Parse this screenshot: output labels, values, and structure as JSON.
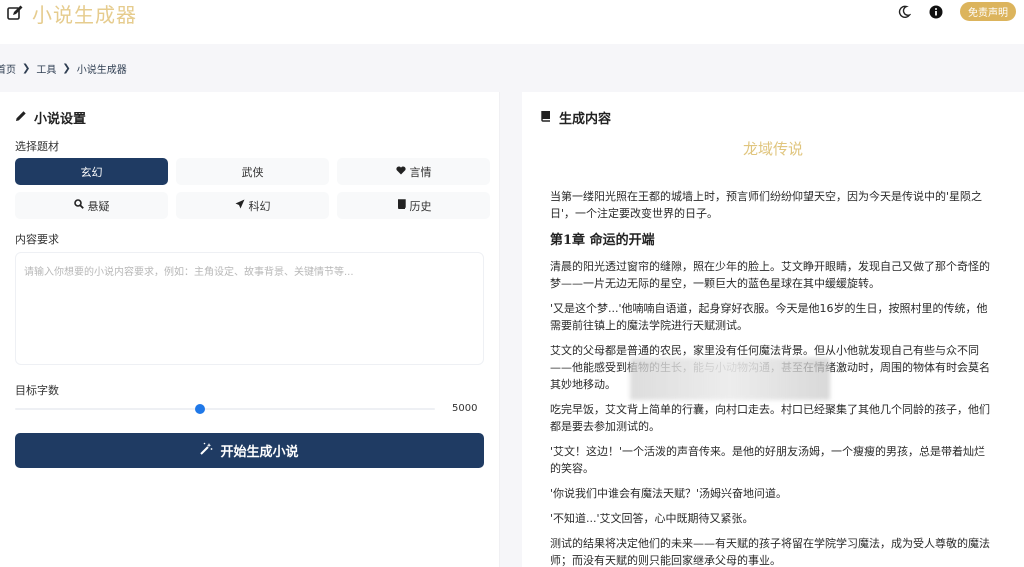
{
  "header": {
    "app_title": "小说生成器",
    "theme_icon": "moon-icon",
    "info_icon": "info-circle-icon",
    "disclaimer_label": "免责声明",
    "brand_icon": "edit-square-icon"
  },
  "breadcrumb": {
    "items": [
      "首页",
      "工具",
      "小说生成器"
    ],
    "separator_icon": "chevron-right-icon"
  },
  "settings": {
    "title": "小说设置",
    "title_icon": "pencil-icon",
    "genre_label": "选择题材",
    "genres": [
      {
        "label": "玄幻",
        "icon": "",
        "active": true
      },
      {
        "label": "武侠",
        "icon": "",
        "active": false
      },
      {
        "label": "言情",
        "icon": "heart-icon",
        "active": false
      },
      {
        "label": "悬疑",
        "icon": "search-icon",
        "active": false
      },
      {
        "label": "科幻",
        "icon": "rocket-icon",
        "active": false
      },
      {
        "label": "历史",
        "icon": "book-icon",
        "active": false
      }
    ],
    "content_label": "内容要求",
    "content_placeholder": "请输入你想要的小说内容要求，例如：主角设定、故事背景、关键情节等...",
    "word_count_label": "目标字数",
    "word_count_value": "5000",
    "slider_fraction": 0.44,
    "generate_label": "开始生成小说",
    "generate_icon": "magic-wand-icon"
  },
  "output": {
    "title": "生成内容",
    "title_icon": "book-icon",
    "story_title": "龙域传说",
    "intro": "当第一缕阳光照在王都的城墙上时，预言师们纷纷仰望天空，因为今天是传说中的'星陨之日'，一个注定要改变世界的日子。",
    "chapter_heading": "第1章 命运的开端",
    "paragraphs": [
      "清晨的阳光透过窗帘的缝隙，照在少年的脸上。艾文睁开眼睛，发现自己又做了那个奇怪的梦——一片无边无际的星空，一颗巨大的蓝色星球在其中缓缓旋转。",
      "'又是这个梦...'他喃喃自语道，起身穿好衣服。今天是他16岁的生日，按照村里的传统，他需要前往镇上的魔法学院进行天赋测试。",
      "艾文的父母都是普通的农民，家里没有任何魔法背景。但从小他就发现自己有些与众不同——他能感受到植物的生长，能与小动物沟通，甚至在情绪激动时，周围的物体有时会莫名其妙地移动。",
      "吃完早饭，艾文背上简单的行囊，向村口走去。村口已经聚集了其他几个同龄的孩子，他们都是要去参加测试的。",
      "'艾文！这边！'一个活泼的声音传来。是他的好朋友汤姆，一个瘦瘦的男孩，总是带着灿烂的笑容。",
      "'你说我们中谁会有魔法天赋？'汤姆兴奋地问道。",
      "'不知道...'艾文回答，心中既期待又紧张。",
      "测试的结果将决定他们的未来——有天赋的孩子将留在学院学习魔法，成为受人尊敬的魔法师；而没有天赋的则只能回家继承父母的事业。"
    ]
  },
  "colors": {
    "primary": "#1f3b63",
    "accent_gold": "#dcb45c",
    "title_gold": "#e6cc8e",
    "slider_blue": "#1f78e8"
  }
}
